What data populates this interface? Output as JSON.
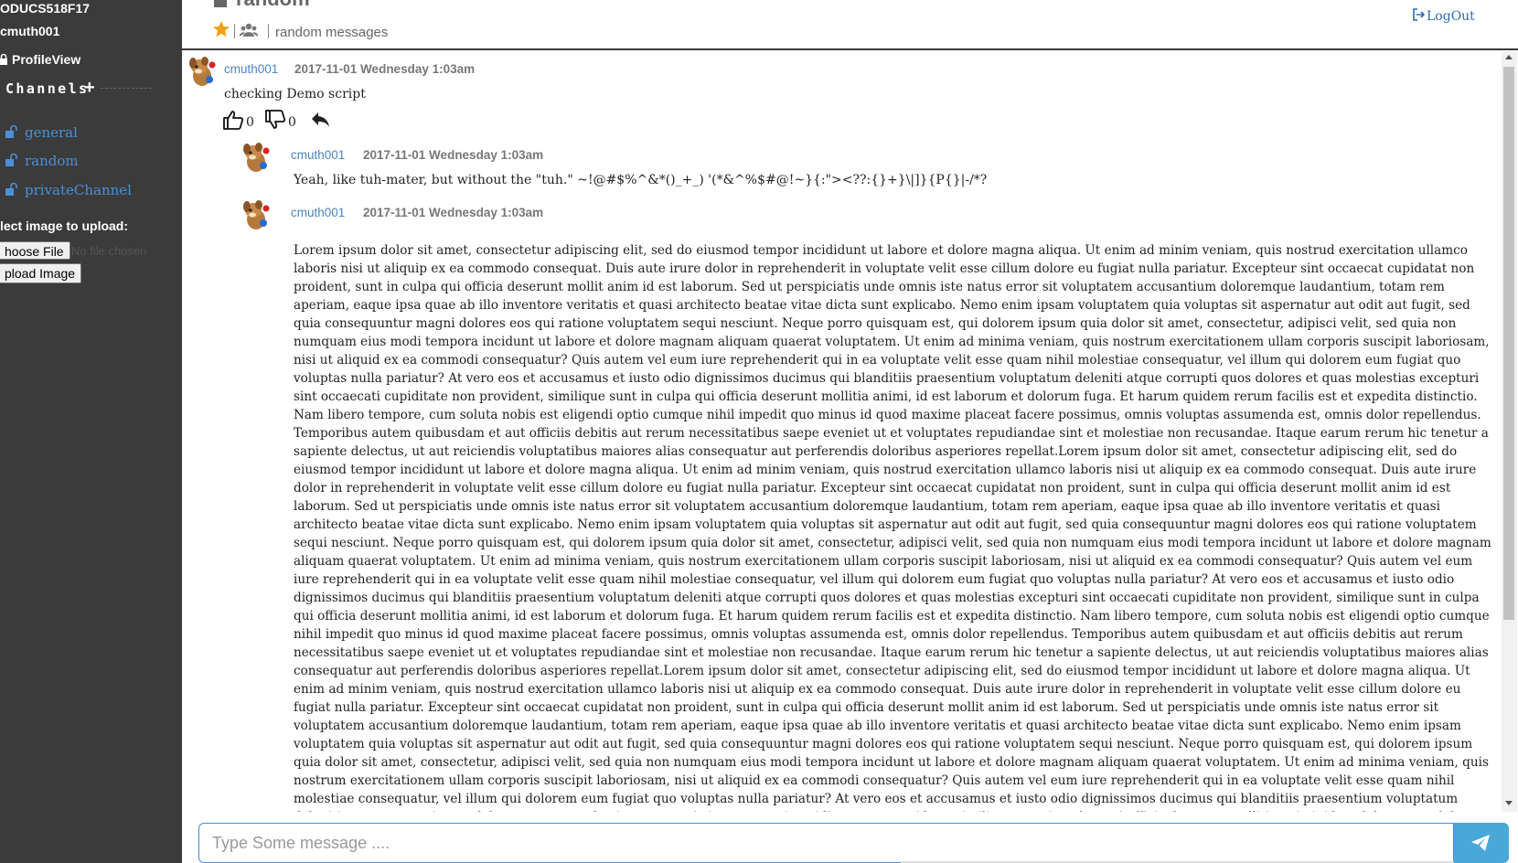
{
  "sidebar": {
    "team": "ODUCS518F17",
    "username": "cmuth001",
    "profile_link": "ProfileView",
    "channels_header": "Channels",
    "channels": [
      {
        "name": "general"
      },
      {
        "name": "random"
      },
      {
        "name": "privateChannel"
      }
    ],
    "upload_label": "lect image to upload:",
    "choose_file_button": "hoose File",
    "no_file_text": "No file chosen",
    "upload_button": "pload Image"
  },
  "header": {
    "channel_title": "random",
    "purpose": "random messages",
    "logout": "LogOut"
  },
  "messages": [
    {
      "user": "cmuth001",
      "time": "2017-11-01 Wednesday 1:03am",
      "text": "checking Demo script",
      "likes": "0",
      "dislikes": "0"
    },
    {
      "user": "cmuth001",
      "time": "2017-11-01 Wednesday 1:03am",
      "text": "Yeah, like tuh-mater, but without the \"tuh.\" ~!@#$%^&*()_+_) '(*&^%$#@!~}{:\"><??:{}+}\\|]}{P{}|-/*?"
    },
    {
      "user": "cmuth001",
      "time": "2017-11-01 Wednesday 1:03am",
      "text": "Lorem ipsum dolor sit amet, consectetur adipiscing elit, sed do eiusmod tempor incididunt ut labore et dolore magna aliqua. Ut enim ad minim veniam, quis nostrud exercitation ullamco laboris nisi ut aliquip ex ea commodo consequat. Duis aute irure dolor in reprehenderit in voluptate velit esse cillum dolore eu fugiat nulla pariatur. Excepteur sint occaecat cupidatat non proident, sunt in culpa qui officia deserunt mollit anim id est laborum. Sed ut perspiciatis unde omnis iste natus error sit voluptatem accusantium doloremque laudantium, totam rem aperiam, eaque ipsa quae ab illo inventore veritatis et quasi architecto beatae vitae dicta sunt explicabo. Nemo enim ipsam voluptatem quia voluptas sit aspernatur aut odit aut fugit, sed quia consequuntur magni dolores eos qui ratione voluptatem sequi nesciunt. Neque porro quisquam est, qui dolorem ipsum quia dolor sit amet, consectetur, adipisci velit, sed quia non numquam eius modi tempora incidunt ut labore et dolore magnam aliquam quaerat voluptatem. Ut enim ad minima veniam, quis nostrum exercitationem ullam corporis suscipit laboriosam, nisi ut aliquid ex ea commodi consequatur? Quis autem vel eum iure reprehenderit qui in ea voluptate velit esse quam nihil molestiae consequatur, vel illum qui dolorem eum fugiat quo voluptas nulla pariatur? At vero eos et accusamus et iusto odio dignissimos ducimus qui blanditiis praesentium voluptatum deleniti atque corrupti quos dolores et quas molestias excepturi sint occaecati cupiditate non provident, similique sunt in culpa qui officia deserunt mollitia animi, id est laborum et dolorum fuga. Et harum quidem rerum facilis est et expedita distinctio. Nam libero tempore, cum soluta nobis est eligendi optio cumque nihil impedit quo minus id quod maxime placeat facere possimus, omnis voluptas assumenda est, omnis dolor repellendus. Temporibus autem quibusdam et aut officiis debitis aut rerum necessitatibus saepe eveniet ut et voluptates repudiandae sint et molestiae non recusandae. Itaque earum rerum hic tenetur a sapiente delectus, ut aut reiciendis voluptatibus maiores alias consequatur aut perferendis doloribus asperiores repellat.Lorem ipsum dolor sit amet, consectetur adipiscing elit, sed do eiusmod tempor incididunt ut labore et dolore magna aliqua. Ut enim ad minim veniam, quis nostrud exercitation ullamco laboris nisi ut aliquip ex ea commodo consequat. Duis aute irure dolor in reprehenderit in voluptate velit esse cillum dolore eu fugiat nulla pariatur. Excepteur sint occaecat cupidatat non proident, sunt in culpa qui officia deserunt mollit anim id est laborum. Sed ut perspiciatis unde omnis iste natus error sit voluptatem accusantium doloremque laudantium, totam rem aperiam, eaque ipsa quae ab illo inventore veritatis et quasi architecto beatae vitae dicta sunt explicabo. Nemo enim ipsam voluptatem quia voluptas sit aspernatur aut odit aut fugit, sed quia consequuntur magni dolores eos qui ratione voluptatem sequi nesciunt. Neque porro quisquam est, qui dolorem ipsum quia dolor sit amet, consectetur, adipisci velit, sed quia non numquam eius modi tempora incidunt ut labore et dolore magnam aliquam quaerat voluptatem. Ut enim ad minima veniam, quis nostrum exercitationem ullam corporis suscipit laboriosam, nisi ut aliquid ex ea commodi consequatur? Quis autem vel eum iure reprehenderit qui in ea voluptate velit esse quam nihil molestiae consequatur, vel illum qui dolorem eum fugiat quo voluptas nulla pariatur? At vero eos et accusamus et iusto odio dignissimos ducimus qui blanditiis praesentium voluptatum deleniti atque corrupti quos dolores et quas molestias excepturi sint occaecati cupiditate non provident, similique sunt in culpa qui officia deserunt mollitia animi, id est laborum et dolorum fuga. Et harum quidem rerum facilis est et expedita distinctio. Nam libero tempore, cum soluta nobis est eligendi optio cumque nihil impedit quo minus id quod maxime placeat facere possimus, omnis voluptas assumenda est, omnis dolor repellendus. Temporibus autem quibusdam et aut officiis debitis aut rerum necessitatibus saepe eveniet ut et voluptates repudiandae sint et molestiae non recusandae. Itaque earum rerum hic tenetur a sapiente delectus, ut aut reiciendis voluptatibus maiores alias consequatur aut perferendis doloribus asperiores repellat.Lorem ipsum dolor sit amet, consectetur adipiscing elit, sed do eiusmod tempor incididunt ut labore et dolore magna aliqua. Ut enim ad minim veniam, quis nostrud exercitation ullamco laboris nisi ut aliquip ex ea commodo consequat. Duis aute irure dolor in reprehenderit in voluptate velit esse cillum dolore eu fugiat nulla pariatur. Excepteur sint occaecat cupidatat non proident, sunt in culpa qui officia deserunt mollit anim id est laborum. Sed ut perspiciatis unde omnis iste natus error sit voluptatem accusantium doloremque laudantium, totam rem aperiam, eaque ipsa quae ab illo inventore veritatis et quasi architecto beatae vitae dicta sunt explicabo. Nemo enim ipsam voluptatem quia voluptas sit aspernatur aut odit aut fugit, sed quia consequuntur magni dolores eos qui ratione voluptatem sequi nesciunt. Neque porro quisquam est, qui dolorem ipsum quia dolor sit amet, consectetur, adipisci velit, sed quia non numquam eius modi tempora incidunt ut labore et dolore magnam aliquam quaerat voluptatem. Ut enim ad minima veniam, quis nostrum exercitationem ullam corporis suscipit laboriosam, nisi ut aliquid ex ea commodi consequatur? Quis autem vel eum iure reprehenderit qui in ea voluptate velit esse quam nihil molestiae consequatur, vel illum qui dolorem eum fugiat quo voluptas nulla pariatur? At vero eos et accusamus et iusto odio dignissimos ducimus qui blanditiis praesentium voluptatum deleniti atque corrupti quos dolores et quas molestias excepturi sint occaecati cupiditate non provident, similique sunt in culpa qui officia deserunt mollitia animi, id est laborum et dolorum fuga. Et harum quidem rerum facilis est et expedita distinctio. Nam libero tempore, cum soluta nobis est eligendi optio cumque nihil impedit quo minus id quod maxime placeat facere possimus, omnis voluptas assumenda est, omnis dolor"
    }
  ],
  "composer": {
    "placeholder": "Type Some message ...."
  },
  "colors": {
    "sidebar_bg": "#3b3b3b",
    "channel_link": "#4a90d9",
    "username_link": "#4a86c0",
    "star": "#f0a010",
    "send_button": "#4aa8d8"
  },
  "icons": [
    "lock-icon",
    "plus-icon",
    "unlock-icon",
    "star-icon",
    "users-icon",
    "logout-icon",
    "thumbs-up-icon",
    "thumbs-down-icon",
    "reply-icon",
    "send-icon",
    "avatar-image"
  ]
}
